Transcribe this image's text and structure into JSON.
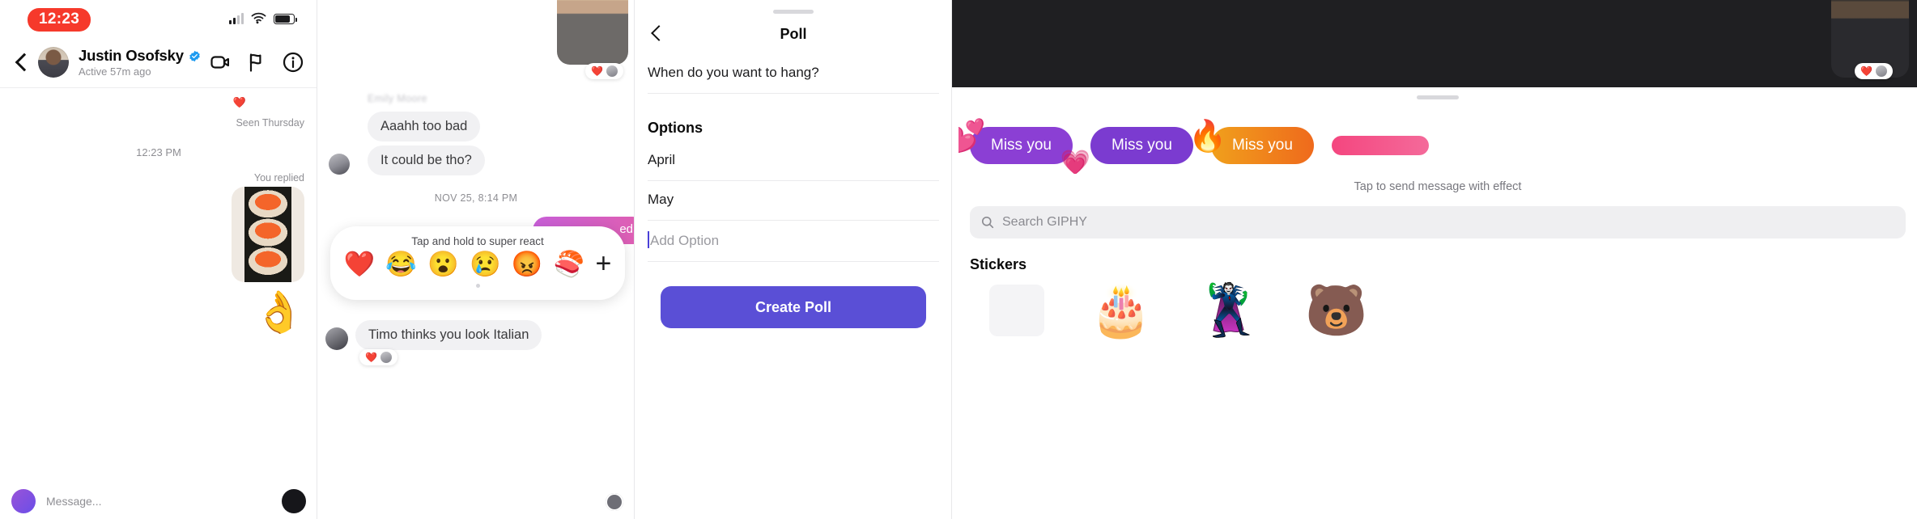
{
  "panel1": {
    "status": {
      "clock": "12:23",
      "signal_icon": "signal-bars-icon",
      "wifi_icon": "wifi-icon",
      "battery_icon": "battery-icon"
    },
    "header": {
      "back_icon": "back-chevron-icon",
      "avatar": "contact-avatar",
      "name": "Justin Osofsky",
      "verified_icon": "verified-badge-icon",
      "subtitle": "Active 57m ago",
      "video_call_icon": "video-camera-icon",
      "flag_icon": "flag-icon",
      "info_icon": "info-circle-icon"
    },
    "thread": {
      "heart_reaction": "❤️",
      "seen_label": "Seen Thursday",
      "timestamp": "12:23 PM",
      "replied_label": "You replied",
      "photo": "sushi-photo",
      "sticker": "👌"
    },
    "composer": {
      "placeholder": "Message...",
      "camera_icon": "camera-icon"
    }
  },
  "panel2": {
    "video_thumb": "video-message-thumbnail",
    "video_reaction": "❤️",
    "sender_name_blurred": "Emily Moore",
    "messages": [
      {
        "text": "Aaahh too bad"
      },
      {
        "text": "It could be tho?"
      }
    ],
    "date_divider": "NOV 25, 8:14 PM",
    "reaction_picker": {
      "hint": "Tap and hold to super react",
      "emojis": [
        "❤️",
        "😂",
        "😮",
        "😢",
        "😡",
        "🍣"
      ],
      "add_label": "+"
    },
    "italian_message": "Timo thinks you look Italian"
  },
  "panel3": {
    "back_icon": "back-chevron-icon",
    "title": "Poll",
    "question": "When do you want to hang?",
    "options_label": "Options",
    "options": [
      "April",
      "May"
    ],
    "add_option_placeholder": "Add Option",
    "create_button": "Create Poll",
    "accent_color": "#5a4fd6",
    "caret_color": "#4a40d8"
  },
  "panel4": {
    "video_thumb": "video-message-thumbnail",
    "video_reaction": "❤️",
    "effects": [
      {
        "label": "Miss you"
      },
      {
        "label": "Miss you"
      },
      {
        "label": "Miss you"
      },
      {
        "label": ""
      }
    ],
    "effects_hint": "Tap to send message with effect",
    "search": {
      "icon": "search-icon",
      "placeholder": "Search GIPHY"
    },
    "stickers_title": "Stickers",
    "stickers": [
      "🎂",
      "🦹",
      "🐻"
    ]
  }
}
